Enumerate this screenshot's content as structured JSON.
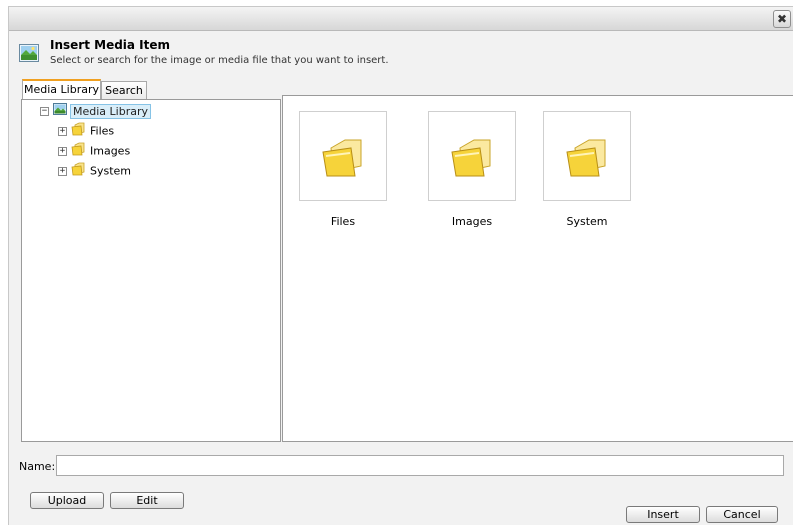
{
  "window": {
    "close_glyph": "✖"
  },
  "header": {
    "title": "Insert Media Item",
    "subtitle": "Select or search for the image or media file that you want to insert.",
    "icon": "media-image-icon"
  },
  "tabs": [
    {
      "label": "Media Library",
      "active": true
    },
    {
      "label": "Search",
      "active": false
    }
  ],
  "tree": {
    "root": {
      "label": "Media Library",
      "expander": "−",
      "icon": "media-library-icon"
    },
    "children": [
      {
        "label": "Files",
        "expander": "+",
        "icon": "folder-icon"
      },
      {
        "label": "Images",
        "expander": "+",
        "icon": "folder-icon"
      },
      {
        "label": "System",
        "expander": "+",
        "icon": "folder-icon"
      }
    ]
  },
  "items": [
    {
      "label": "Files",
      "icon": "folder-icon"
    },
    {
      "label": "Images",
      "icon": "folder-icon"
    },
    {
      "label": "System",
      "icon": "folder-icon"
    }
  ],
  "name_field": {
    "label": "Name:",
    "value": "",
    "placeholder": ""
  },
  "buttons": {
    "upload": "Upload",
    "edit": "Edit",
    "insert": "Insert",
    "cancel": "Cancel"
  },
  "colors": {
    "active_tab_accent": "#f0a020",
    "selected_node_bg": "#d9eef9",
    "folder_yellow": "#f6d33a"
  }
}
